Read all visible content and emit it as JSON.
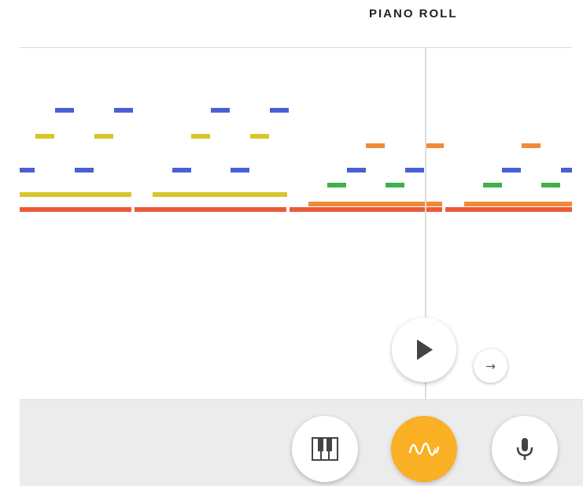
{
  "header": {
    "title": "PIANO ROLL"
  },
  "colors": {
    "blue": "#4a5fd6",
    "yellow": "#d8c52a",
    "orange": "#f08a38",
    "green": "#3fb04a",
    "red": "#ec5a3a",
    "accent": "#f9b024",
    "bottom_bar": "#ececec"
  },
  "controls": {
    "play_icon": "play-icon",
    "next_icon": "arrow-right-icon",
    "modes": [
      {
        "icon": "piano-keys-icon",
        "active": false
      },
      {
        "icon": "waveform-icon",
        "active": true
      },
      {
        "icon": "microphone-icon",
        "active": false
      }
    ]
  },
  "next_glyph": "→"
}
